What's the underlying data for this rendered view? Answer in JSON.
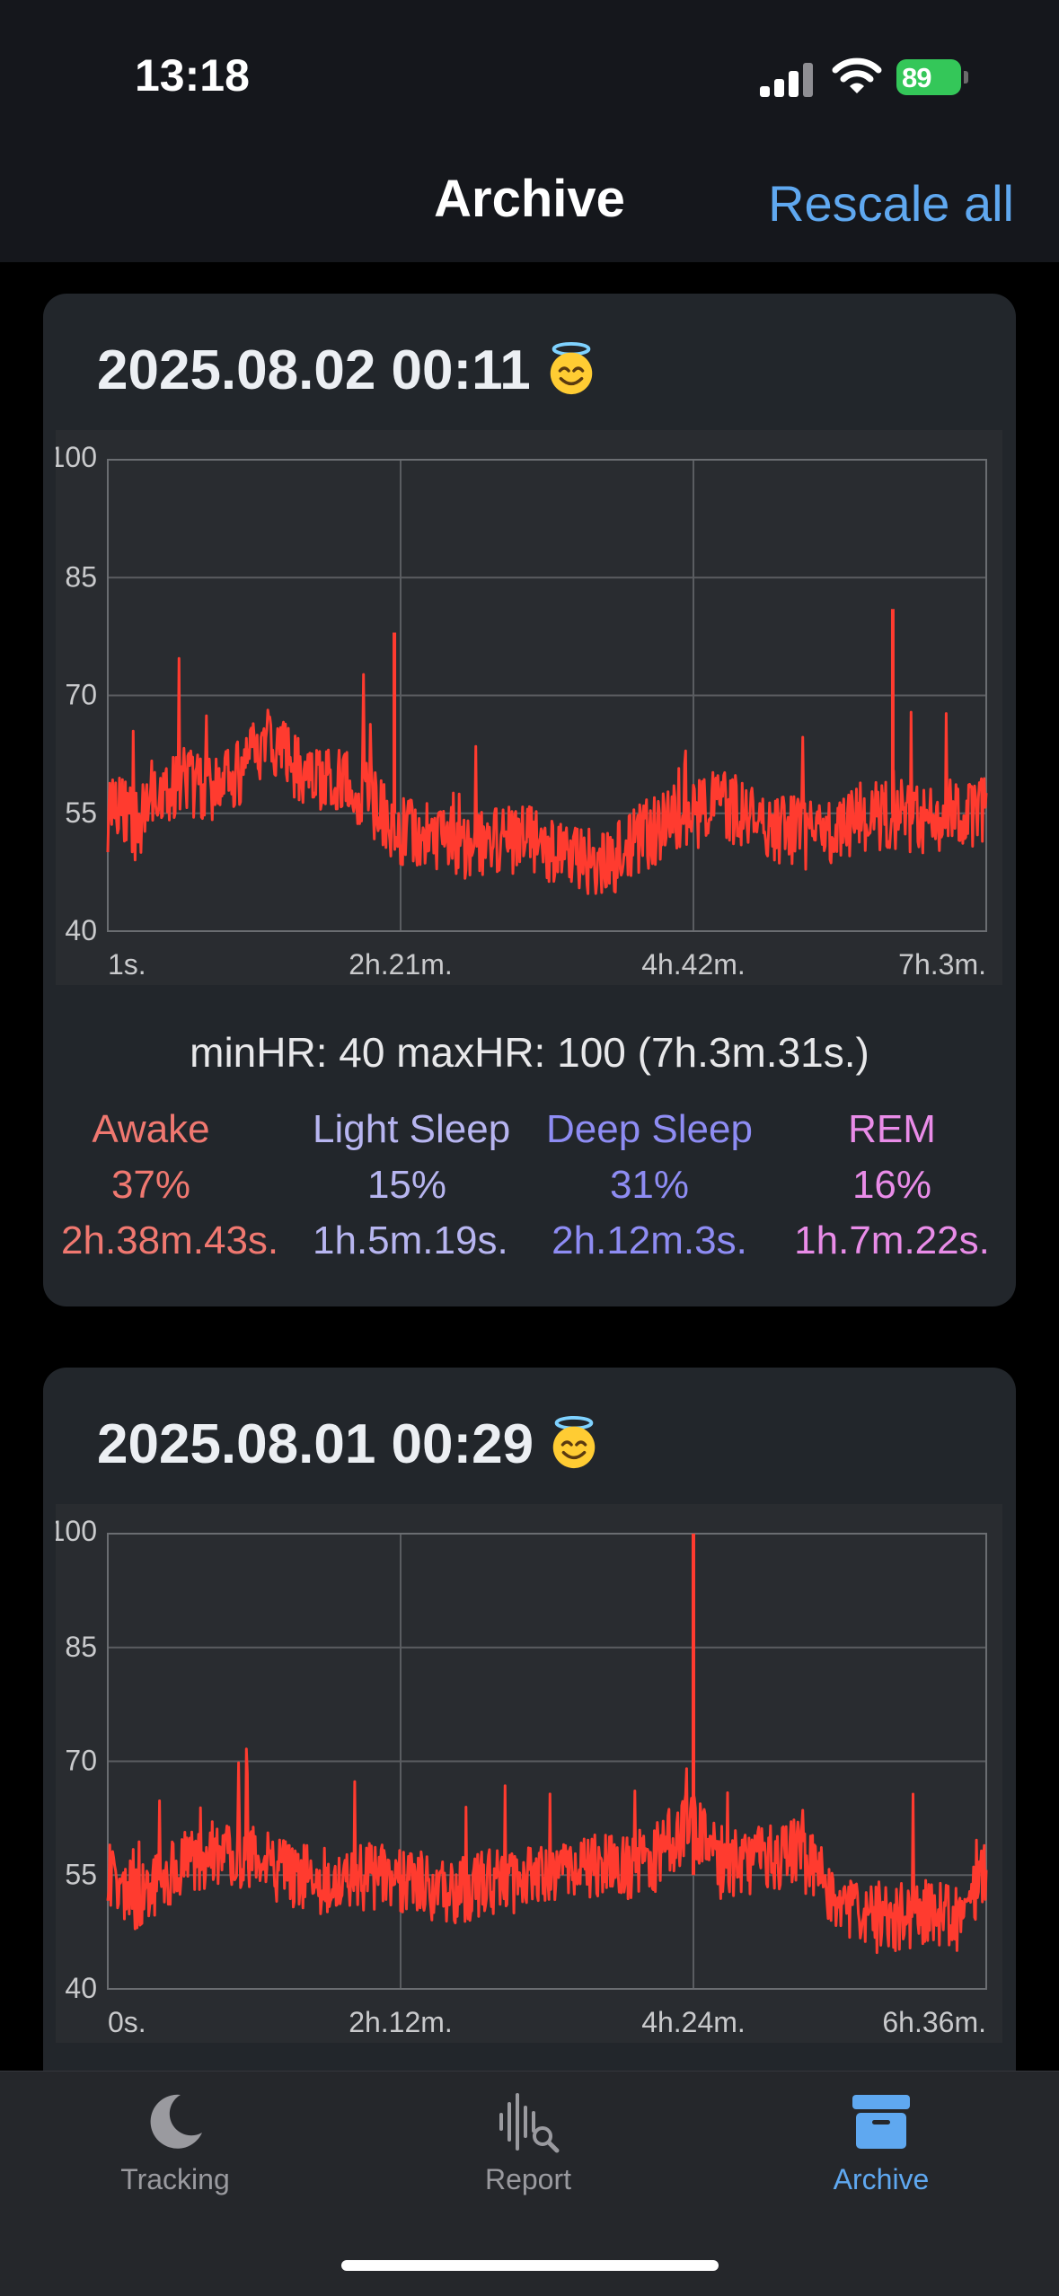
{
  "status_bar": {
    "time": "13:18",
    "battery_percent": "89"
  },
  "nav": {
    "title": "Archive",
    "rescale_label": "Rescale all"
  },
  "cards": [
    {
      "title": "2025.08.02 00:11",
      "summary": "minHR: 40 maxHR: 100 (7h.3m.31s.)",
      "stages": [
        {
          "name": "Awake",
          "percent": "37%",
          "duration": "2h.38m.43s."
        },
        {
          "name": "Light Sleep",
          "percent": "15%",
          "duration": "1h.5m.19s."
        },
        {
          "name": "Deep Sleep",
          "percent": "31%",
          "duration": "2h.12m.3s."
        },
        {
          "name": "REM",
          "percent": "16%",
          "duration": "1h.7m.22s."
        }
      ]
    },
    {
      "title": "2025.08.01 00:29"
    }
  ],
  "chart_data": [
    {
      "type": "line",
      "y_ticks": [
        "100",
        "85",
        "70",
        "55",
        "40"
      ],
      "x_ticks": [
        "1s.",
        "2h.21m.",
        "4h.42m.",
        "7h.3m."
      ],
      "ylim": [
        40,
        100
      ],
      "grid": true,
      "series": [
        {
          "color": "#ff3b2f",
          "x_hours": [
            0.0,
            0.1,
            0.2,
            0.4,
            0.6,
            0.9,
            1.1,
            1.3,
            1.5,
            1.7,
            1.9,
            2.1,
            2.3,
            2.6,
            2.9,
            3.2,
            3.5,
            3.8,
            4.0,
            4.2,
            4.4,
            4.6,
            4.9,
            5.1,
            5.4,
            5.7,
            6.0,
            6.3,
            6.6,
            6.8,
            7.05
          ],
          "y": [
            54,
            57,
            53,
            57,
            59,
            58,
            61,
            64,
            61,
            60,
            59,
            57,
            53,
            52,
            51,
            52,
            51,
            49,
            48,
            51,
            53,
            54,
            56,
            55,
            53,
            52,
            54,
            55,
            54,
            55,
            55
          ]
        }
      ],
      "annotations": [
        "peak at 2.3h = 78",
        "peak at 6.3h = 81"
      ]
    },
    {
      "type": "line",
      "y_ticks": [
        "100",
        "85",
        "70",
        "55",
        "40"
      ],
      "x_ticks": [
        "0s.",
        "2h.12m.",
        "4h.24m.",
        "6h.36m."
      ],
      "ylim": [
        40,
        100
      ],
      "grid": true,
      "series": [
        {
          "color": "#ff3b2f",
          "x_hours": [
            0.0,
            0.2,
            0.5,
            0.8,
            1.1,
            1.4,
            1.7,
            2.0,
            2.3,
            2.6,
            2.9,
            3.2,
            3.5,
            3.8,
            4.1,
            4.4,
            4.6,
            4.9,
            5.2,
            5.5,
            5.8,
            6.1,
            6.4,
            6.6
          ],
          "y": [
            55,
            52,
            56,
            58,
            57,
            55,
            54,
            55,
            54,
            53,
            54,
            55,
            56,
            56,
            57,
            62,
            56,
            57,
            58,
            51,
            49,
            50,
            49,
            55
          ]
        }
      ],
      "annotations": [
        "peak at 4.4h = 100"
      ]
    }
  ],
  "tabs": [
    {
      "label": "Tracking",
      "icon": "moon-icon",
      "active": false
    },
    {
      "label": "Report",
      "icon": "waveform-search-icon",
      "active": false
    },
    {
      "label": "Archive",
      "icon": "archive-box-icon",
      "active": true
    }
  ]
}
